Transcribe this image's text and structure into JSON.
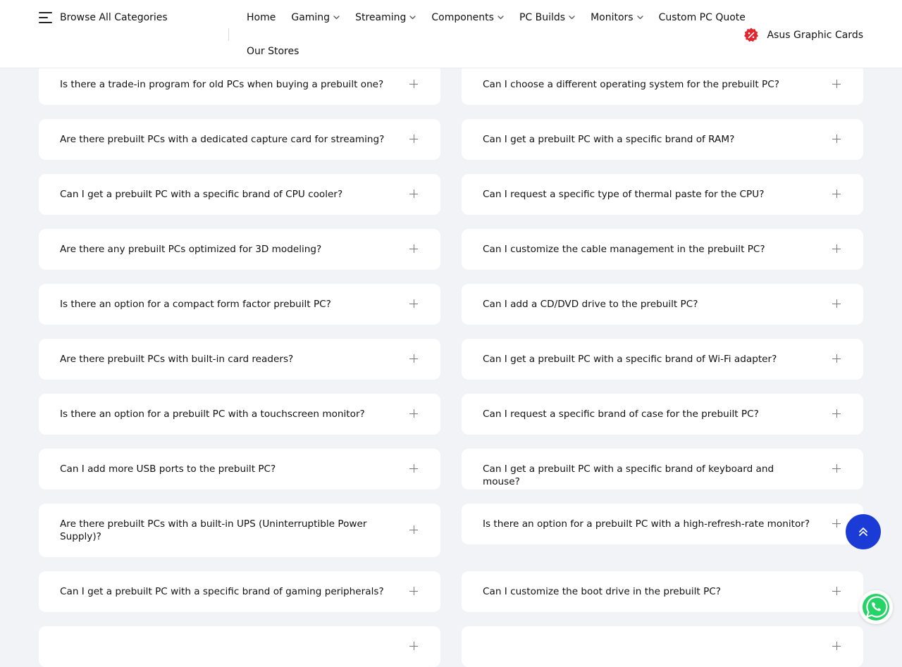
{
  "header": {
    "browse_label": "Browse All Categories",
    "nav_row1": [
      {
        "label": "Home",
        "has_dropdown": false
      },
      {
        "label": "Gaming",
        "has_dropdown": true
      },
      {
        "label": "Streaming",
        "has_dropdown": true
      },
      {
        "label": "Components",
        "has_dropdown": true
      },
      {
        "label": "PC Builds",
        "has_dropdown": true
      },
      {
        "label": "Monitors",
        "has_dropdown": true
      },
      {
        "label": "Custom PC Quote",
        "has_dropdown": false
      }
    ],
    "nav_row2": [
      {
        "label": "Our Stores",
        "has_dropdown": false
      }
    ],
    "promo_label": "Asus Graphic Cards",
    "promo_icon": "discount-badge-icon",
    "promo_color": "#e0262f"
  },
  "faq": {
    "left": [
      "Is there a trade-in program for old PCs when buying a prebuilt one?",
      "Are there prebuilt PCs with a dedicated capture card for streaming?",
      "Can I get a prebuilt PC with a specific brand of CPU cooler?",
      "Are there any prebuilt PCs optimized for 3D modeling?",
      "Is there an option for a compact form factor prebuilt PC?",
      "Are there prebuilt PCs with built-in card readers?",
      "Is there an option for a prebuilt PC with a touchscreen monitor?",
      "Can I add more USB ports to the prebuilt PC?",
      "Are there prebuilt PCs with a built-in UPS (Uninterruptible Power Supply)?",
      "Can I get a prebuilt PC with a specific brand of gaming peripherals?",
      ""
    ],
    "right": [
      "Can I choose a different operating system for the prebuilt PC?",
      "Can I get a prebuilt PC with a specific brand of RAM?",
      "Can I request a specific type of thermal paste for the CPU?",
      "Can I customize the cable management in the prebuilt PC?",
      "Can I add a CD/DVD drive to the prebuilt PC?",
      "Can I get a prebuilt PC with a specific brand of Wi-Fi adapter?",
      "Can I request a specific brand of case for the prebuilt PC?",
      "Can I get a prebuilt PC with a specific brand of keyboard and mouse?",
      "Is there an option for a prebuilt PC with a high-refresh-rate monitor?",
      "Can I customize the boot drive in the prebuilt PC?",
      ""
    ],
    "expand_icon": "plus-icon"
  },
  "floating": {
    "scroll_top_icon": "double-chevron-up-icon",
    "scroll_top_color": "#1a3bd6",
    "whatsapp_icon": "whatsapp-icon",
    "whatsapp_color": "#25d366"
  }
}
